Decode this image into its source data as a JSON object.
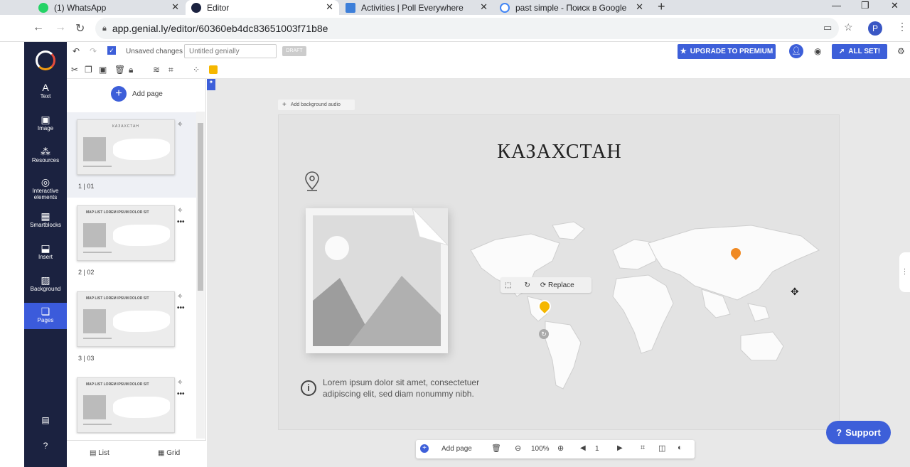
{
  "browser": {
    "tabs": [
      {
        "title": "(1) WhatsApp",
        "favicon_color": "#25d366"
      },
      {
        "title": "Editor",
        "favicon_color": "#1b2240"
      },
      {
        "title": "Activities | Poll Everywhere",
        "favicon_color": "#3d7fd9"
      },
      {
        "title": "past simple - Поиск в Google",
        "favicon_color": "#4285f4"
      }
    ],
    "url": "app.genial.ly/editor/60360eb4dc83651003f71b8e",
    "profile_initial": "P"
  },
  "leftnav": {
    "items": [
      {
        "label": "Text",
        "icon": "text-icon"
      },
      {
        "label": "Image",
        "icon": "image-icon"
      },
      {
        "label": "Resources",
        "icon": "resources-icon"
      },
      {
        "label": "Interactive elements",
        "icon": "interactive-icon"
      },
      {
        "label": "Smartblocks",
        "icon": "smartblocks-icon"
      },
      {
        "label": "Insert",
        "icon": "insert-icon"
      },
      {
        "label": "Background",
        "icon": "background-icon"
      },
      {
        "label": "Pages",
        "icon": "pages-icon"
      }
    ]
  },
  "toolbar": {
    "status": "Unsaved changes",
    "title_placeholder": "Untitled genially",
    "draft": "DRAFT",
    "premium": "UPGRADE TO PREMIUM",
    "allset": "ALL SET!"
  },
  "panel": {
    "add_page": "Add page",
    "pages": [
      {
        "num": "1",
        "name": "01",
        "thumb_title": "КАЗАХСТАН"
      },
      {
        "num": "2",
        "name": "02",
        "thumb_title": "MAP LIST LOREM IPSUM DOLOR SIT"
      },
      {
        "num": "3",
        "name": "03",
        "thumb_title": "MAP LIST LOREM IPSUM DOLOR SIT"
      },
      {
        "num": "",
        "name": "",
        "thumb_title": "MAP LIST LOREM IPSUM DOLOR SIT"
      }
    ],
    "tab_list": "List",
    "tab_grid": "Grid"
  },
  "canvas": {
    "bg_audio": "Add background audio",
    "title": "КАЗАХСТАН",
    "lorem": "Lorem ipsum dolor sit amet, consectetuer adipiscing elit, sed diam nonummy nibh.",
    "replace": "Replace",
    "marker_color": "#f39c12"
  },
  "bottombar": {
    "add_page": "Add page",
    "zoom": "100%",
    "page": "1"
  },
  "support": "Support"
}
